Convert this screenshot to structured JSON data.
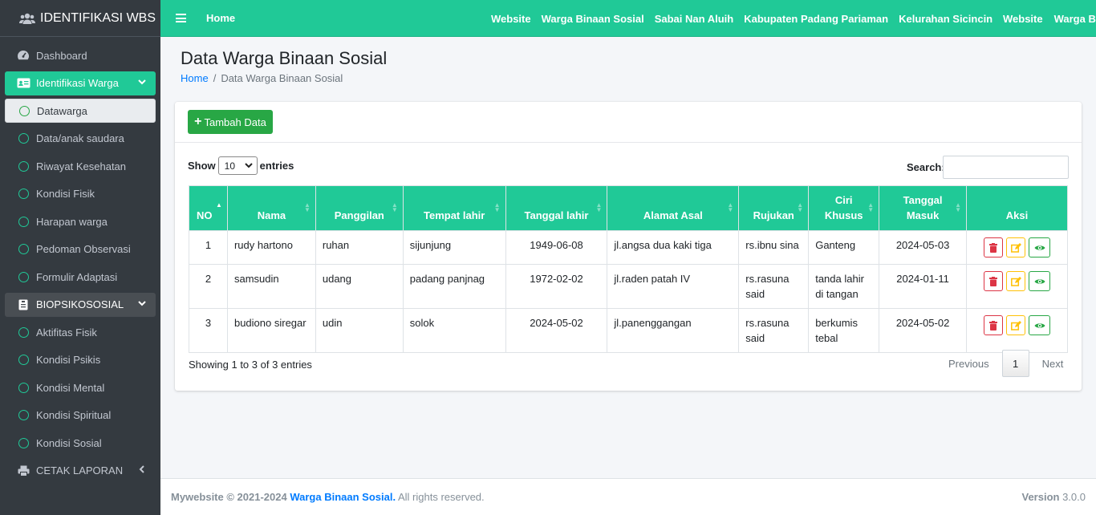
{
  "brand": {
    "title": "IDENTIFIKASI WBS"
  },
  "sidebar": {
    "items": [
      {
        "label": "Dashboard"
      },
      {
        "label": "Identifikasi Warga"
      },
      {
        "label": "Datawarga"
      },
      {
        "label": "Data/anak saudara"
      },
      {
        "label": "Riwayat Kesehatan"
      },
      {
        "label": "Kondisi Fisik"
      },
      {
        "label": "Harapan warga"
      },
      {
        "label": "Pedoman Observasi"
      },
      {
        "label": "Formulir Adaptasi"
      },
      {
        "label": "BIOPSIKOSOSIAL"
      },
      {
        "label": "Aktifitas Fisik"
      },
      {
        "label": "Kondisi Psikis"
      },
      {
        "label": "Kondisi Mental"
      },
      {
        "label": "Kondisi Spiritual"
      },
      {
        "label": "Kondisi Sosial"
      },
      {
        "label": "CETAK LAPORAN"
      }
    ]
  },
  "topbar": {
    "home": "Home",
    "links": [
      "Website",
      "Warga Binaan Sosial",
      "Sabai Nan Aluih",
      "Kabupaten Padang Pariaman",
      "Kelurahan Sicincin"
    ],
    "links2": [
      "Website",
      "Warga Binaan Sosial"
    ]
  },
  "page": {
    "title": "Data Warga Binaan Sosial",
    "breadcrumb_home": "Home",
    "breadcrumb_sep": "/",
    "breadcrumb_current": "Data Warga Binaan Sosial"
  },
  "toolbar": {
    "add_label": "Tambah Data"
  },
  "table_controls": {
    "show_label": "Show",
    "entries_value": "10",
    "entries_label": "entries",
    "search_label": "Search:"
  },
  "table": {
    "headers": [
      "NO",
      "Nama",
      "Panggilan",
      "Tempat lahir",
      "Tanggal lahir",
      "Alamat Asal",
      "Rujukan",
      "Ciri Khusus",
      "Tanggal Masuk",
      "Aksi"
    ],
    "rows": [
      [
        "1",
        "rudy hartono",
        "ruhan",
        "sijunjung",
        "1949-06-08",
        "jl.angsa dua kaki tiga",
        "rs.ibnu sina",
        "Ganteng",
        "2024-05-03"
      ],
      [
        "2",
        "samsudin",
        "udang",
        "padang panjnag",
        "1972-02-02",
        "jl.raden patah IV",
        "rs.rasuna said",
        "tanda lahir di tangan",
        "2024-01-11"
      ],
      [
        "3",
        "budiono siregar",
        "udin",
        "solok",
        "2024-05-02",
        "jl.panenggangan",
        "rs.rasuna said",
        "berkumis tebal",
        "2024-05-02"
      ]
    ]
  },
  "pagination": {
    "info": "Showing 1 to 3 of 3 entries",
    "previous": "Previous",
    "current": "1",
    "next": "Next"
  },
  "footer": {
    "copyright": "Mywebsite © 2021-2024",
    "brand": "Warga Binaan Sosial.",
    "rights": "All rights reserved.",
    "version_label": "Version",
    "version": "3.0.0"
  },
  "colors": {
    "accent": "#20c997",
    "sidebar": "#343a40",
    "primary": "#007bff",
    "success": "#28a745",
    "danger": "#dc3545",
    "warning": "#ffc107"
  }
}
